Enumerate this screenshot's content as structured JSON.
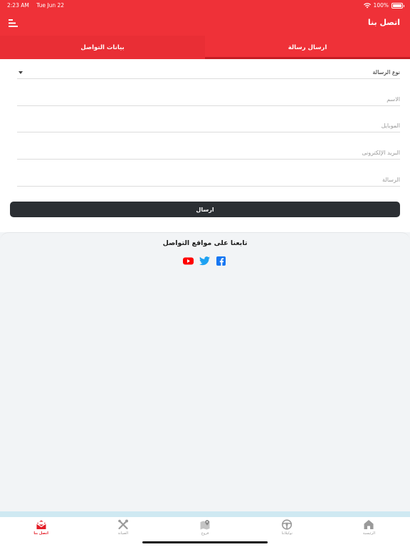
{
  "status_bar": {
    "time": "2:23 AM",
    "date": "Tue Jun 22",
    "battery": "100%"
  },
  "header": {
    "title": "اتصل بنا"
  },
  "tabs": [
    {
      "label": "ارسال رسالة",
      "active": true
    },
    {
      "label": "بيانات التواصل",
      "active": false
    }
  ],
  "form": {
    "message_type": "نوع الرسالة",
    "name_placeholder": "الاسم",
    "mobile_placeholder": "الموبايل",
    "email_placeholder": "البريد الإلكترونى",
    "message_placeholder": "الرسالة",
    "submit_label": "ارسال"
  },
  "follow": {
    "title": "تابعنا على مواقع التواصل",
    "icons": [
      "facebook-icon",
      "twitter-icon",
      "youtube-icon"
    ]
  },
  "bottom_nav": [
    {
      "label": "الرئيسية",
      "icon": "home-icon",
      "active": false
    },
    {
      "label": "توكيلاتنا",
      "icon": "steering-wheel-icon",
      "active": false
    },
    {
      "label": "فروع",
      "icon": "map-pin-icon",
      "active": false
    },
    {
      "label": "الصيانة",
      "icon": "tools-icon",
      "active": false
    },
    {
      "label": "اتصل بنا",
      "icon": "envelope-icon",
      "active": true
    }
  ],
  "colors": {
    "primary": "#ef3138",
    "dark_button": "#2b2f33",
    "active_nav": "#e31c26",
    "facebook": "#1877f2",
    "twitter": "#1da1f2",
    "youtube": "#ff0000"
  }
}
